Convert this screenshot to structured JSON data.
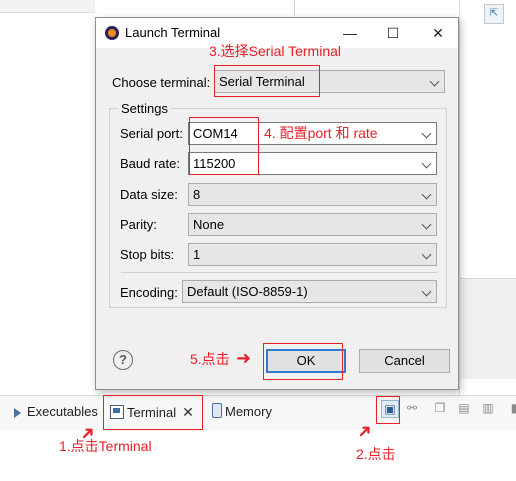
{
  "dialog": {
    "title": "Launch Terminal",
    "window_buttons": {
      "minimize": "—",
      "maximize": "☐",
      "close": "✕"
    },
    "choose_terminal_label": "Choose terminal:",
    "choose_terminal_value": "Serial Terminal",
    "settings_group_title": "Settings",
    "fields": {
      "serial_port": {
        "label": "Serial port:",
        "value": "COM14"
      },
      "baud_rate": {
        "label": "Baud rate:",
        "value": "115200"
      },
      "data_size": {
        "label": "Data size:",
        "value": "8"
      },
      "parity": {
        "label": "Parity:",
        "value": "None"
      },
      "stop_bits": {
        "label": "Stop bits:",
        "value": "1"
      },
      "encoding": {
        "label": "Encoding:",
        "value": "Default (ISO-8859-1)"
      }
    },
    "help_glyph": "?",
    "ok_label": "OK",
    "cancel_label": "Cancel"
  },
  "bottom_tabs": [
    {
      "label": "Executables",
      "icon": "run-icon"
    },
    {
      "label": "Terminal",
      "icon": "terminal-icon",
      "close": "✕"
    },
    {
      "label": "Memory",
      "icon": "memory-icon"
    }
  ],
  "annotations": {
    "step1": "1.点击Terminal",
    "step2": "2.点击",
    "step3": "3.选择Serial Terminal",
    "step4": "4. 配置port 和 rate",
    "step5": "5.点击",
    "arrow": "➜"
  },
  "colors": {
    "annotation_red": "#e8202a",
    "default_button_border": "#2f7bd3",
    "dialog_bg": "#f0f0f0"
  }
}
